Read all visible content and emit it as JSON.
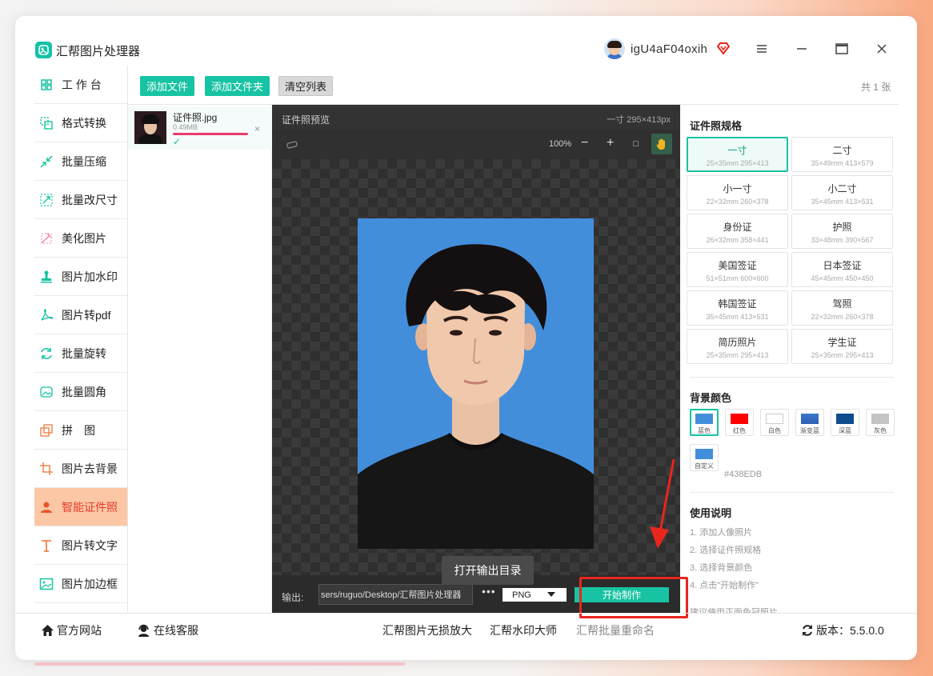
{
  "app": {
    "title": "汇帮图片处理器",
    "username": "igU4aF04oxih"
  },
  "sidebar": {
    "items": [
      {
        "label": "工 作 台",
        "icon": "grid-icon"
      },
      {
        "label": "格式转换",
        "icon": "convert-icon"
      },
      {
        "label": "批量压缩",
        "icon": "compress-icon"
      },
      {
        "label": "批量改尺寸",
        "icon": "resize-icon"
      },
      {
        "label": "美化图片",
        "icon": "beautify-icon"
      },
      {
        "label": "图片加水印",
        "icon": "watermark-icon"
      },
      {
        "label": "图片转pdf",
        "icon": "pdf-icon"
      },
      {
        "label": "批量旋转",
        "icon": "rotate-icon"
      },
      {
        "label": "批量圆角",
        "icon": "round-corner-icon"
      },
      {
        "label": "拼　图",
        "icon": "puzzle-icon"
      },
      {
        "label": "图片去背景",
        "icon": "remove-bg-icon"
      },
      {
        "label": "智能证件照",
        "icon": "person-icon",
        "active": true
      },
      {
        "label": "图片转文字",
        "icon": "text-icon"
      },
      {
        "label": "图片加边框",
        "icon": "frame-icon"
      }
    ]
  },
  "toolbar": {
    "add_file": "添加文件",
    "add_folder": "添加文件夹",
    "clear_list": "清空列表",
    "count": "共 1 张"
  },
  "file": {
    "name": "证件照.jpg",
    "size": "0.49MB",
    "status": "✓",
    "close": "×"
  },
  "preview": {
    "title": "证件照预览",
    "size_label": "一寸 295×413px",
    "zoom": "100%",
    "zoom_out": "−",
    "zoom_in": "+",
    "open_dir": "打开输出目录",
    "output_label": "输出:",
    "output_path": "sers/ruguo/Desktop/汇帮图片处理器",
    "more": "•••",
    "format": "PNG",
    "start": "开始制作"
  },
  "specs": {
    "title": "证件照规格",
    "items": [
      {
        "name": "一寸",
        "dim": "25×35mm 295×413",
        "active": true
      },
      {
        "name": "二寸",
        "dim": "35×49mm 413×579"
      },
      {
        "name": "小一寸",
        "dim": "22×32mm 260×378"
      },
      {
        "name": "小二寸",
        "dim": "35×45mm 413×531"
      },
      {
        "name": "身份证",
        "dim": "26×32mm 358×441"
      },
      {
        "name": "护照",
        "dim": "33×48mm 390×567"
      },
      {
        "name": "美国签证",
        "dim": "51×51mm 600×600"
      },
      {
        "name": "日本签证",
        "dim": "45×45mm 450×450"
      },
      {
        "name": "韩国签证",
        "dim": "35×45mm 413×531"
      },
      {
        "name": "驾照",
        "dim": "22×32mm 260×378"
      },
      {
        "name": "简历照片",
        "dim": "25×35mm 295×413"
      },
      {
        "name": "学生证",
        "dim": "25×35mm 295×413"
      }
    ]
  },
  "background": {
    "title": "背景颜色",
    "colors": [
      {
        "name": "蓝色",
        "color": "#438EDB",
        "active": true
      },
      {
        "name": "红色",
        "color": "#FF0000"
      },
      {
        "name": "白色",
        "color": "#FFFFFF"
      },
      {
        "name": "渐变蓝",
        "color": "#3A78CF"
      },
      {
        "name": "深蓝",
        "color": "#0F4C8C"
      },
      {
        "name": "灰色",
        "color": "#C4C4C4"
      },
      {
        "name": "自定义",
        "color": "#438EDB"
      }
    ],
    "hex": "#438EDB"
  },
  "usage": {
    "title": "使用说明",
    "steps": [
      "1. 添加人像照片",
      "2. 选择证件照规格",
      "3. 选择背景颜色",
      "4. 点击\"开始制作\"",
      "建议使用正面免冠照片"
    ]
  },
  "footer": {
    "website": "官方网站",
    "support": "在线客服",
    "link1": "汇帮图片无损放大",
    "link2": "汇帮水印大师",
    "link3": "汇帮批量重命名",
    "version_label": "版本：",
    "version": "5.5.0.0"
  },
  "colors": {
    "accent": "#17C3A3",
    "active_bg": "#FCC7A5",
    "active_text": "#E53B2C",
    "highlight": "#E8261D"
  }
}
